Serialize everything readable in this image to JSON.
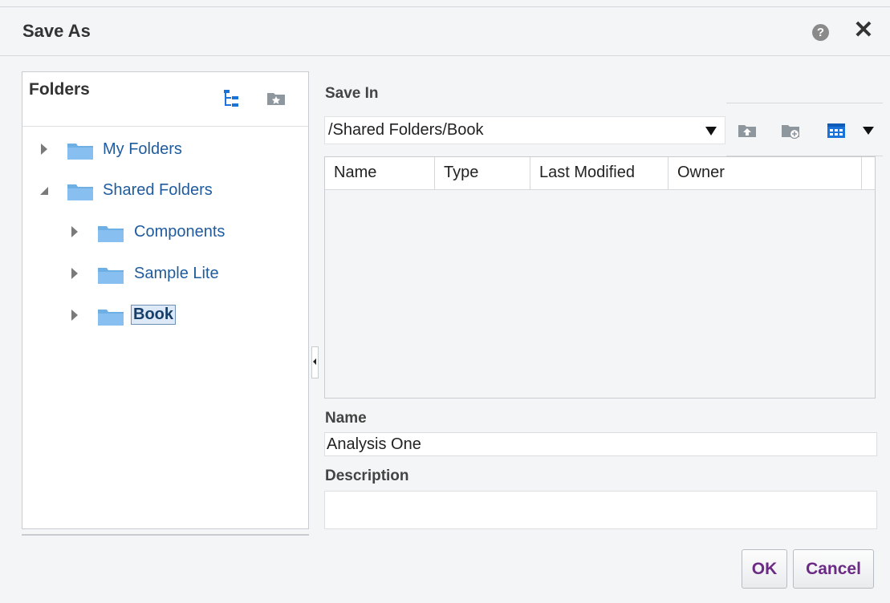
{
  "dialog": {
    "title": "Save As",
    "help_symbol": "?",
    "close_symbol": "✕"
  },
  "folders": {
    "title": "Folders",
    "items": [
      {
        "label": "My Folders",
        "expanded": false
      },
      {
        "label": "Shared Folders",
        "expanded": true
      },
      {
        "label": "Components",
        "expanded": false
      },
      {
        "label": "Sample Lite",
        "expanded": false
      },
      {
        "label": "Book",
        "expanded": false,
        "selected": true
      }
    ]
  },
  "save_in": {
    "label": "Save In",
    "path": "/Shared Folders/Book"
  },
  "toolbar": {
    "icons": [
      "up-folder-icon",
      "new-folder-icon",
      "view-options-icon"
    ]
  },
  "grid": {
    "columns": [
      "Name",
      "Type",
      "Last Modified",
      "Owner"
    ]
  },
  "name_field": {
    "label": "Name",
    "value": "Analysis One"
  },
  "description_field": {
    "label": "Description",
    "value": ""
  },
  "buttons": {
    "ok": "OK",
    "cancel": "Cancel"
  },
  "colors": {
    "link_blue": "#1f5b9d",
    "folder_blue": "#6fb0e4",
    "button_text": "#6b2a83",
    "view_icon_blue": "#1a73d9"
  }
}
